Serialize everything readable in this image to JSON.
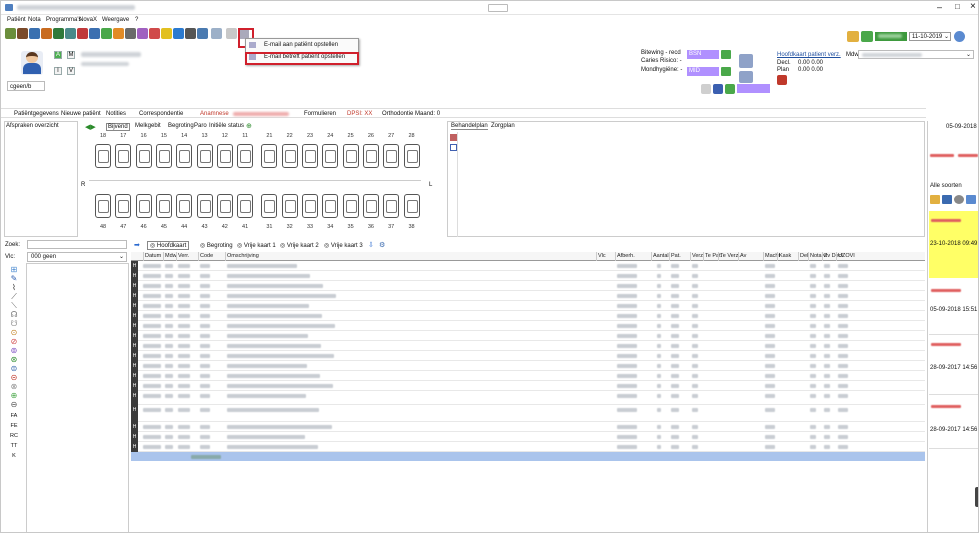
{
  "window": {
    "controls": {
      "minimize": "–",
      "maximize": "□",
      "close": "×"
    }
  },
  "menu": [
    "Patiënt",
    "Nota",
    "Programma's",
    "NovaX",
    "Weergave",
    "?"
  ],
  "dropdown": {
    "items": [
      "E-mail aan patiënt opstellen",
      "E-mail betreft patiënt opstellen"
    ]
  },
  "patient": {
    "buttons": [
      "A",
      "M",
      "I",
      "V"
    ],
    "name_placeholder": "cgeen/b"
  },
  "risk": {
    "labels": [
      "Bitewing - recd",
      "Caries Risico: -",
      "Mondhygiëne: -"
    ],
    "bsn": "BSN",
    "mid": "MID",
    "col": [
      "Hoofdkaart patient verz.",
      "Decl.",
      "Plan"
    ],
    "values": [
      "0.00  0.00",
      "0.00  0.00"
    ],
    "mdw_label": "Mdw"
  },
  "date": {
    "top": "11-10-2019"
  },
  "infobar": {
    "patientgegevens": "Patiëntgegevens",
    "nieuwe": "Nieuwe patiënt",
    "notities": "Notities",
    "correspondentie": "Correspondentie",
    "anamnese": "Anamnese",
    "formulieren": "Formulieren",
    "dpsi": "DPSI: XX",
    "ortho": "Orthodontie Maand: 0"
  },
  "left": {
    "afspraken": "Afspraken overzicht",
    "zoek_label": "Zoek:",
    "vlc_label": "Vlc:",
    "vlc_value": "000 geen",
    "side_icons": [
      "FA",
      "FE",
      "RC",
      "TT",
      "K"
    ]
  },
  "tooth_tabs": [
    "Bijvend",
    "Melkgebit",
    "Begroting",
    "Paro",
    "Initiële status"
  ],
  "tooth_sides": {
    "left": "R",
    "right": "L"
  },
  "upper_teeth": [
    "18",
    "17",
    "16",
    "15",
    "14",
    "13",
    "12",
    "11",
    "21",
    "22",
    "23",
    "24",
    "25",
    "26",
    "27",
    "28"
  ],
  "lower_teeth": [
    "48",
    "47",
    "46",
    "45",
    "44",
    "43",
    "42",
    "41",
    "31",
    "32",
    "33",
    "34",
    "35",
    "36",
    "37",
    "38"
  ],
  "plan_tabs": [
    "Behandelplan",
    "Zorgplan"
  ],
  "kaart_tabs": [
    "Hoofdkaart",
    "Begroting",
    "Vrije kaart 1",
    "Vrije kaart 2",
    "Vrije kaart 3"
  ],
  "columns": [
    "Datum",
    "Mdw",
    "Verr.",
    "Code",
    "Omschrijving",
    "Vlc",
    "Afberh.",
    "Aantal",
    "Pat.",
    "Verz.",
    "Te Pat.",
    "Te Verz.",
    "Av",
    "Macht",
    "Kask",
    "Del",
    "NotaNr",
    "Zv Decl.",
    "UZOVI"
  ],
  "row_marker": "H",
  "rows": 18,
  "right_panel": {
    "top_date": "05-09-2018",
    "alle_soorten": "Alle soorten",
    "entries": [
      "23-10-2018 09:49",
      "05-09-2018 15:51",
      "28-09-2017 14:56",
      "28-09-2017 14:56"
    ]
  },
  "colors": {
    "selected_row": "#aac4ec",
    "highlight": "#ffff66",
    "red_box": "#d0202c",
    "purple": "#b090ff",
    "green": "#4aa84a"
  }
}
